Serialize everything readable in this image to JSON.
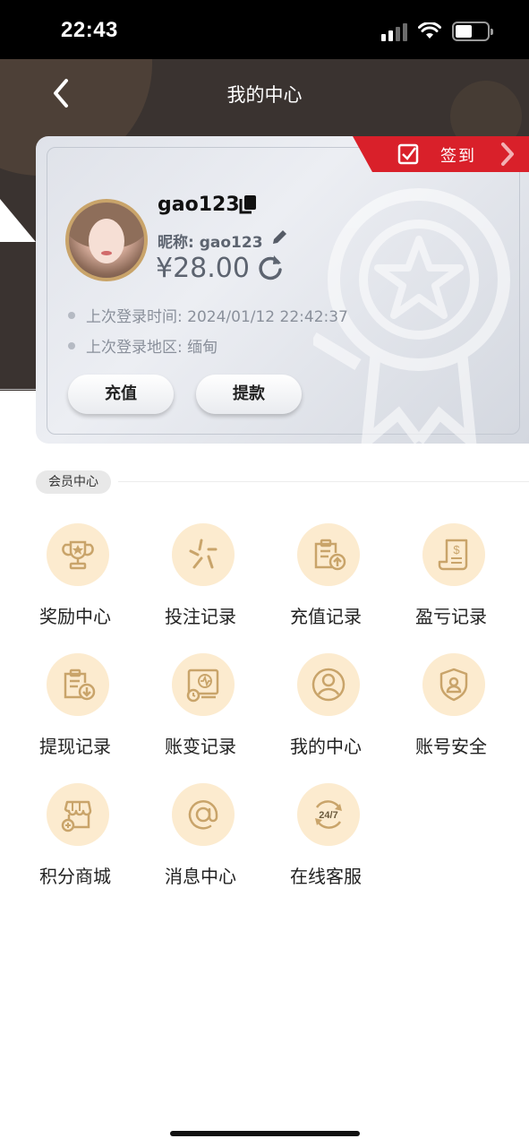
{
  "status_bar": {
    "time": "22:43"
  },
  "header": {
    "title": "我的中心"
  },
  "card": {
    "signin_label": "签到",
    "username": "gao123",
    "nickname": "昵称: gao123",
    "balance": "¥28.00",
    "last_login_time": "上次登录时间: 2024/01/12 22:42:37",
    "last_login_region": "上次登录地区: 缅甸",
    "recharge_label": "充值",
    "withdraw_label": "提款"
  },
  "section": {
    "title": "会员中心",
    "items": [
      {
        "label": "奖励中心",
        "icon": "trophy-icon"
      },
      {
        "label": "投注记录",
        "icon": "bet-record-icon"
      },
      {
        "label": "充值记录",
        "icon": "recharge-record-icon"
      },
      {
        "label": "盈亏记录",
        "icon": "profit-loss-icon"
      },
      {
        "label": "提现记录",
        "icon": "withdraw-record-icon"
      },
      {
        "label": "账变记录",
        "icon": "account-change-icon"
      },
      {
        "label": "我的中心",
        "icon": "user-icon"
      },
      {
        "label": "账号安全",
        "icon": "shield-user-icon"
      },
      {
        "label": "积分商城",
        "icon": "shop-icon"
      },
      {
        "label": "消息中心",
        "icon": "at-icon"
      },
      {
        "label": "在线客服",
        "icon": "support-24-7-icon"
      }
    ]
  },
  "colors": {
    "accent_gold": "#c9a46a",
    "icon_bg": "#fcebcf",
    "signin_red": "#d9202a"
  }
}
